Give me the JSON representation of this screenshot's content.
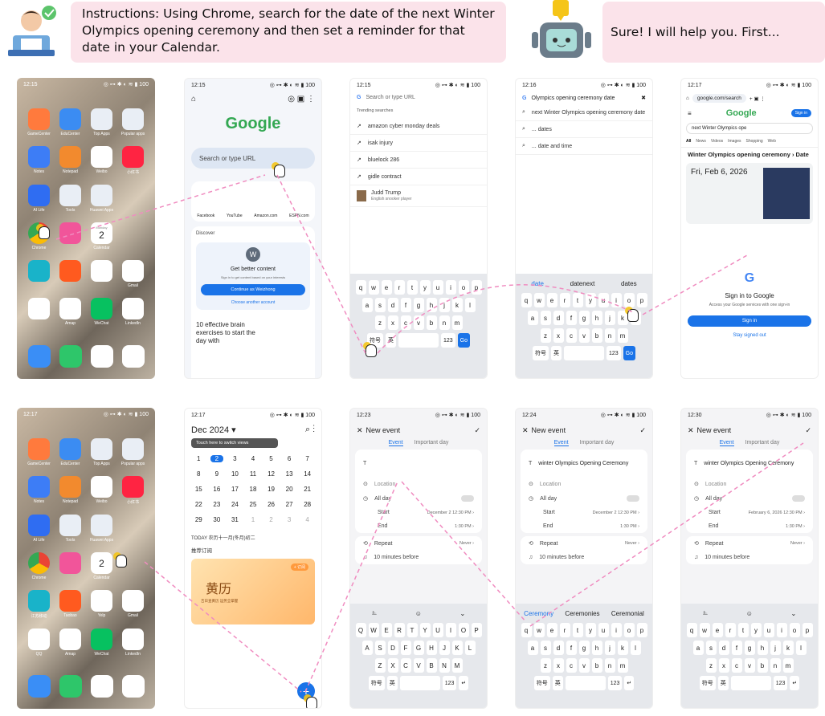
{
  "header": {
    "instruction_text": "Instructions: Using Chrome, search for the date of the next Winter Olympics opening ceremony and then set a reminder for that date in your Calendar.",
    "agent_text": "Sure! I will help you. First..."
  },
  "status": {
    "t1": "12:15",
    "t2": "12:15",
    "t3": "12:15",
    "t4": "12:16",
    "t5": "12:17",
    "t6": "12:17",
    "t7": "12:17",
    "t8": "12:23",
    "t9": "12:24",
    "t10": "12:30",
    "right": "◎ ⊶ ✱ ◐ ≋ ▮ 100"
  },
  "apps": {
    "row1": [
      "GameCenter",
      "EduCenter",
      "Top Apps",
      "Popular apps"
    ],
    "row2": [
      "Notes",
      "Notepad",
      "Weibo",
      "小红书"
    ],
    "row3": [
      "AI Life",
      "Tools",
      "Huawei Apps",
      ""
    ],
    "row4": [
      "Chrome",
      "",
      "Calendar",
      ""
    ],
    "row5": [
      "江苏移动",
      "Taobao",
      "Yelp",
      "Gmail"
    ],
    "row6": [
      "QQ",
      "Amap",
      "WeChat",
      "LinkedIn"
    ],
    "calendar_day": "2",
    "calendar_weekday": "Monday"
  },
  "chrome_home": {
    "search_placeholder": "Search or type URL",
    "shortcuts": [
      "Facebook",
      "YouTube",
      "Amazon.com",
      "ESPN.com"
    ],
    "discover": "Discover",
    "avatar_letter": "W",
    "better_title": "Get better content",
    "better_sub": "Sign in to get content based on your interests",
    "continue_btn": "Continue as Weizhong",
    "choose_other": "Choose another account",
    "article": "10 effective brain exercises to start the day with"
  },
  "chrome_search": {
    "placeholder": "Search or type URL",
    "trending": "Trending searches",
    "items": [
      "amazon cyber monday deals",
      "isak injury",
      "bluelock 286",
      "gidle contract",
      "Judd Trump"
    ],
    "judd_sub": "English snooker player"
  },
  "chrome_typed": {
    "query": "Olympics opening ceremony date",
    "suggestions": [
      "next Winter Olympics opening ceremony date",
      "... dates",
      "... date and time"
    ],
    "kb_suggestions": [
      "date",
      "datenext",
      "dates"
    ]
  },
  "results": {
    "url": "google.com/search",
    "query": "next Winter Olympics ope",
    "tabs": [
      "All",
      "News",
      "Videos",
      "Images",
      "Shopping",
      "Web"
    ],
    "heading": "Winter Olympics opening ceremony › Date",
    "date": "Fri, Feb 6, 2026",
    "sign_in_title": "Sign in to Google",
    "sign_in_sub": "Access your Google services with one sign-in",
    "sign_in_btn": "Sign in",
    "stay_out": "Stay signed out",
    "signin_top": "Sign in"
  },
  "calendar": {
    "month": "Dec 2024 ▾",
    "tooltip": "Touch here to switch views",
    "weekday_labels": [
      "",
      "",
      "",
      "",
      "",
      "HU",
      "FRI",
      "SAT"
    ],
    "weeks": [
      [
        "1",
        "2",
        "3",
        "4",
        "5",
        "6",
        "7"
      ],
      [
        "8",
        "9",
        "10",
        "11",
        "12",
        "13",
        "14"
      ],
      [
        "15",
        "16",
        "17",
        "18",
        "19",
        "20",
        "21"
      ],
      [
        "22",
        "23",
        "24",
        "25",
        "26",
        "27",
        "28"
      ],
      [
        "29",
        "30",
        "31",
        "1",
        "2",
        "3",
        "4"
      ]
    ],
    "today_line": "TODAY 农历十一月(冬月)初二",
    "recommend": "推荐订阅",
    "banner_text": "黄历",
    "banner_sub": "吉日查黄历 运势全掌握",
    "subscribe": "+ 订阅"
  },
  "event": {
    "title": "New event",
    "tab_event": "Event",
    "tab_important": "Important day",
    "location": "Location",
    "all_day": "All day",
    "start": "Start",
    "end": "End",
    "start_val": "December 2 12:30 PM",
    "end_val": "1:30 PM",
    "repeat": "Repeat",
    "repeat_val": "Never",
    "remind": "10 minutes before",
    "typed_title": "winter Olympics Opening Ceremony",
    "final_title": "winter Olympics Opening Ceremony",
    "final_start": "February 6, 2026 12:30 PM",
    "kb_suggest": [
      "Ceremony",
      "Ceremonies",
      "Ceremonial"
    ]
  },
  "keyboard": {
    "row1": [
      "q",
      "w",
      "e",
      "r",
      "t",
      "y",
      "u",
      "i",
      "o",
      "p"
    ],
    "row2": [
      "a",
      "s",
      "d",
      "f",
      "g",
      "h",
      "j",
      "k",
      "l"
    ],
    "row3": [
      "z",
      "x",
      "c",
      "v",
      "b",
      "n",
      "m"
    ],
    "row1u": [
      "Q",
      "W",
      "E",
      "R",
      "T",
      "Y",
      "U",
      "I",
      "O",
      "P"
    ],
    "row2u": [
      "A",
      "S",
      "D",
      "F",
      "G",
      "H",
      "J",
      "K",
      "L"
    ],
    "row3u": [
      "Z",
      "X",
      "C",
      "V",
      "B",
      "N",
      "M"
    ],
    "sym": "符号",
    "lang": "英",
    "num": "123",
    "go": "Go"
  },
  "colors": {
    "accent": "#1a73e8",
    "pink": "#fbe3ea",
    "dash": "#f08cc0"
  }
}
